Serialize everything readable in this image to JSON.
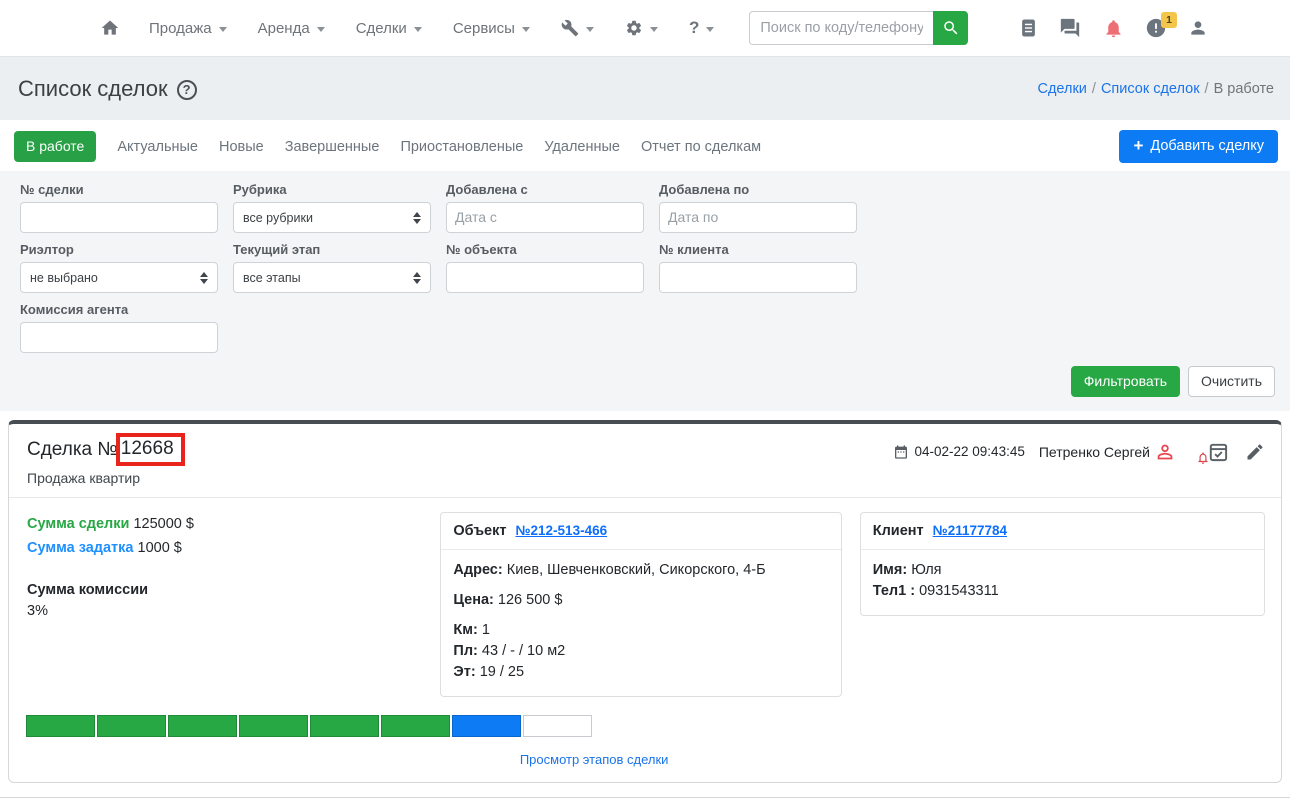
{
  "topnav": {
    "menu": [
      {
        "label": "Продажа"
      },
      {
        "label": "Аренда"
      },
      {
        "label": "Сделки"
      },
      {
        "label": "Сервисы"
      }
    ],
    "help_menu_label": "?",
    "search_placeholder": "Поиск по коду/телефону",
    "notifications_badge": "1"
  },
  "page_header": {
    "title": "Список сделок",
    "help_glyph": "?",
    "separator": "/",
    "breadcrumb": [
      {
        "label": "Сделки"
      },
      {
        "label": "Список сделок"
      },
      {
        "label": "В работе"
      }
    ]
  },
  "tabs": {
    "active_label": "В работе",
    "items": [
      {
        "label": "Актуальные"
      },
      {
        "label": "Новые"
      },
      {
        "label": "Завершенные"
      },
      {
        "label": "Приостановленые"
      },
      {
        "label": "Удаленные"
      },
      {
        "label": "Отчет по сделкам"
      }
    ],
    "add_button": {
      "plus": "+",
      "label": "Добавить сделку"
    }
  },
  "filters": {
    "deal_number": {
      "label": "№ сделки",
      "value": ""
    },
    "rubric": {
      "label": "Рубрика",
      "value": "все рубрики"
    },
    "added_from": {
      "label": "Добавлена с",
      "placeholder": "Дата с",
      "value": ""
    },
    "added_to": {
      "label": "Добавлена по",
      "placeholder": "Дата по",
      "value": ""
    },
    "realtor": {
      "label": "Риэлтор",
      "value": "не выбрано"
    },
    "stage": {
      "label": "Текущий этап",
      "value": "все этапы"
    },
    "object_number": {
      "label": "№ объекта",
      "value": ""
    },
    "client_number": {
      "label": "№ клиента",
      "value": ""
    },
    "agent_commission": {
      "label": "Комиссия агента",
      "value": ""
    },
    "filter_button": "Фильтровать",
    "clear_button": "Очистить"
  },
  "deal": {
    "title_prefix": "Сделка №",
    "number": "12668",
    "category": "Продажа квартир",
    "created_at": "04-02-22 09:43:45",
    "responsible": "Петренко Сергей",
    "sums": {
      "amount_label": "Сумма сделки",
      "amount_value": "125000 $",
      "deposit_label": "Сумма задатка",
      "deposit_value": "1000 $",
      "commission_label": "Сумма комиссии",
      "commission_value": "3%"
    },
    "object": {
      "title": "Объект",
      "number_link": "№212-513-466",
      "address_label": "Адрес:",
      "address_value": "Киев, Шевченковский, Сикорского, 4-Б",
      "price_label": "Цена:",
      "price_value": "126 500 $",
      "rooms_label": "Км:",
      "rooms_value": "1",
      "area_label": "Пл:",
      "area_value": "43 / - / 10 м2",
      "floor_label": "Эт:",
      "floor_value": "19 / 25"
    },
    "client": {
      "title": "Клиент",
      "number_link": "№21177784",
      "name_label": "Имя:",
      "name_value": "Юля",
      "phone_label": "Тел1 :",
      "phone_value": "0931543311"
    },
    "progress": {
      "segments": [
        "done",
        "done",
        "done",
        "done",
        "done",
        "done",
        "current",
        "empty"
      ],
      "colors": {
        "done": "#28a745",
        "current": "#0d7bf3",
        "empty": "#ffffff"
      }
    },
    "stages_link": "Просмотр этапов сделки"
  },
  "colors": {
    "accent_green": "#28a745",
    "accent_blue": "#0d7bf3",
    "link_blue": "#1a73e8",
    "annotation_red": "#e8241c",
    "bell_pink": "#ee6e76"
  }
}
